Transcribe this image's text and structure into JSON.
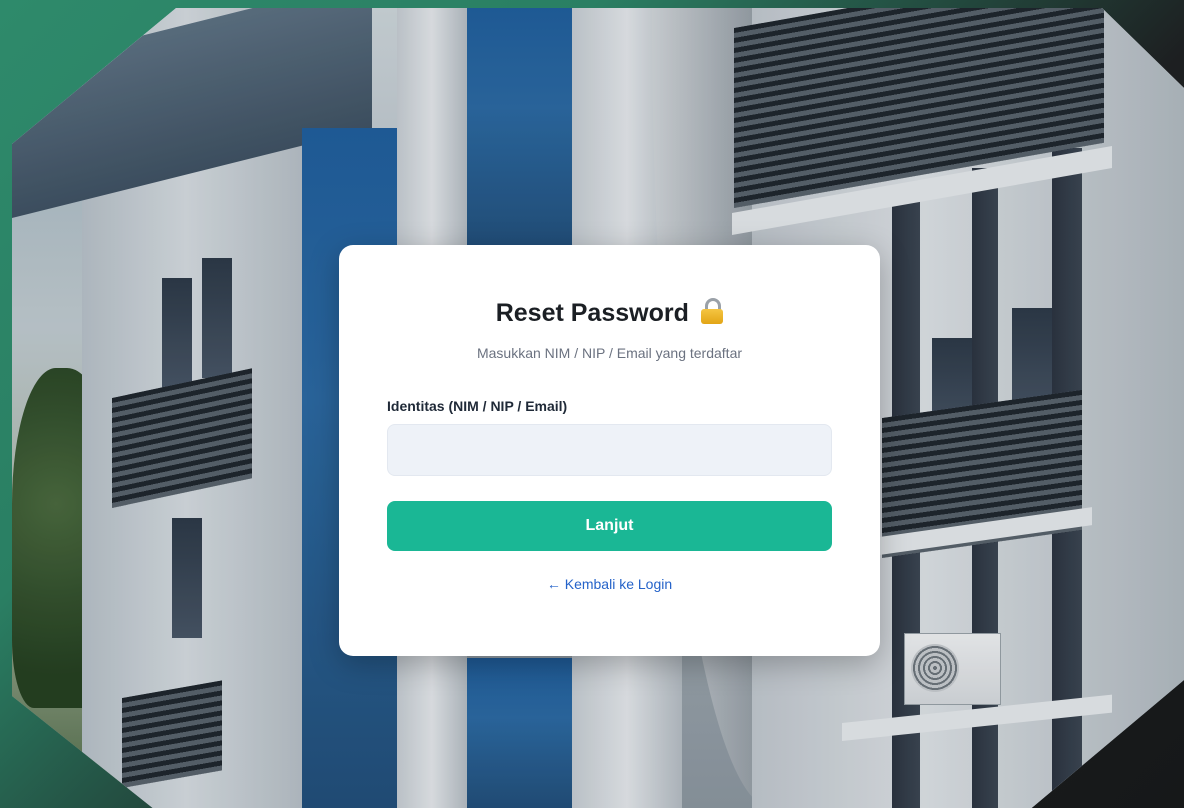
{
  "card": {
    "title": "Reset Password",
    "title_icon": "lock-icon",
    "subtitle": "Masukkan NIM / NIP / Email yang terdaftar",
    "field": {
      "label": "Identitas (NIM / NIP / Email)",
      "value": "",
      "placeholder": ""
    },
    "submit_label": "Lanjut",
    "back_link_label": "← Kembali ke Login"
  },
  "colors": {
    "accent": "#1ab795",
    "link": "#2563c9",
    "frame_green": "#2e8a6b",
    "frame_dark": "#161819"
  }
}
